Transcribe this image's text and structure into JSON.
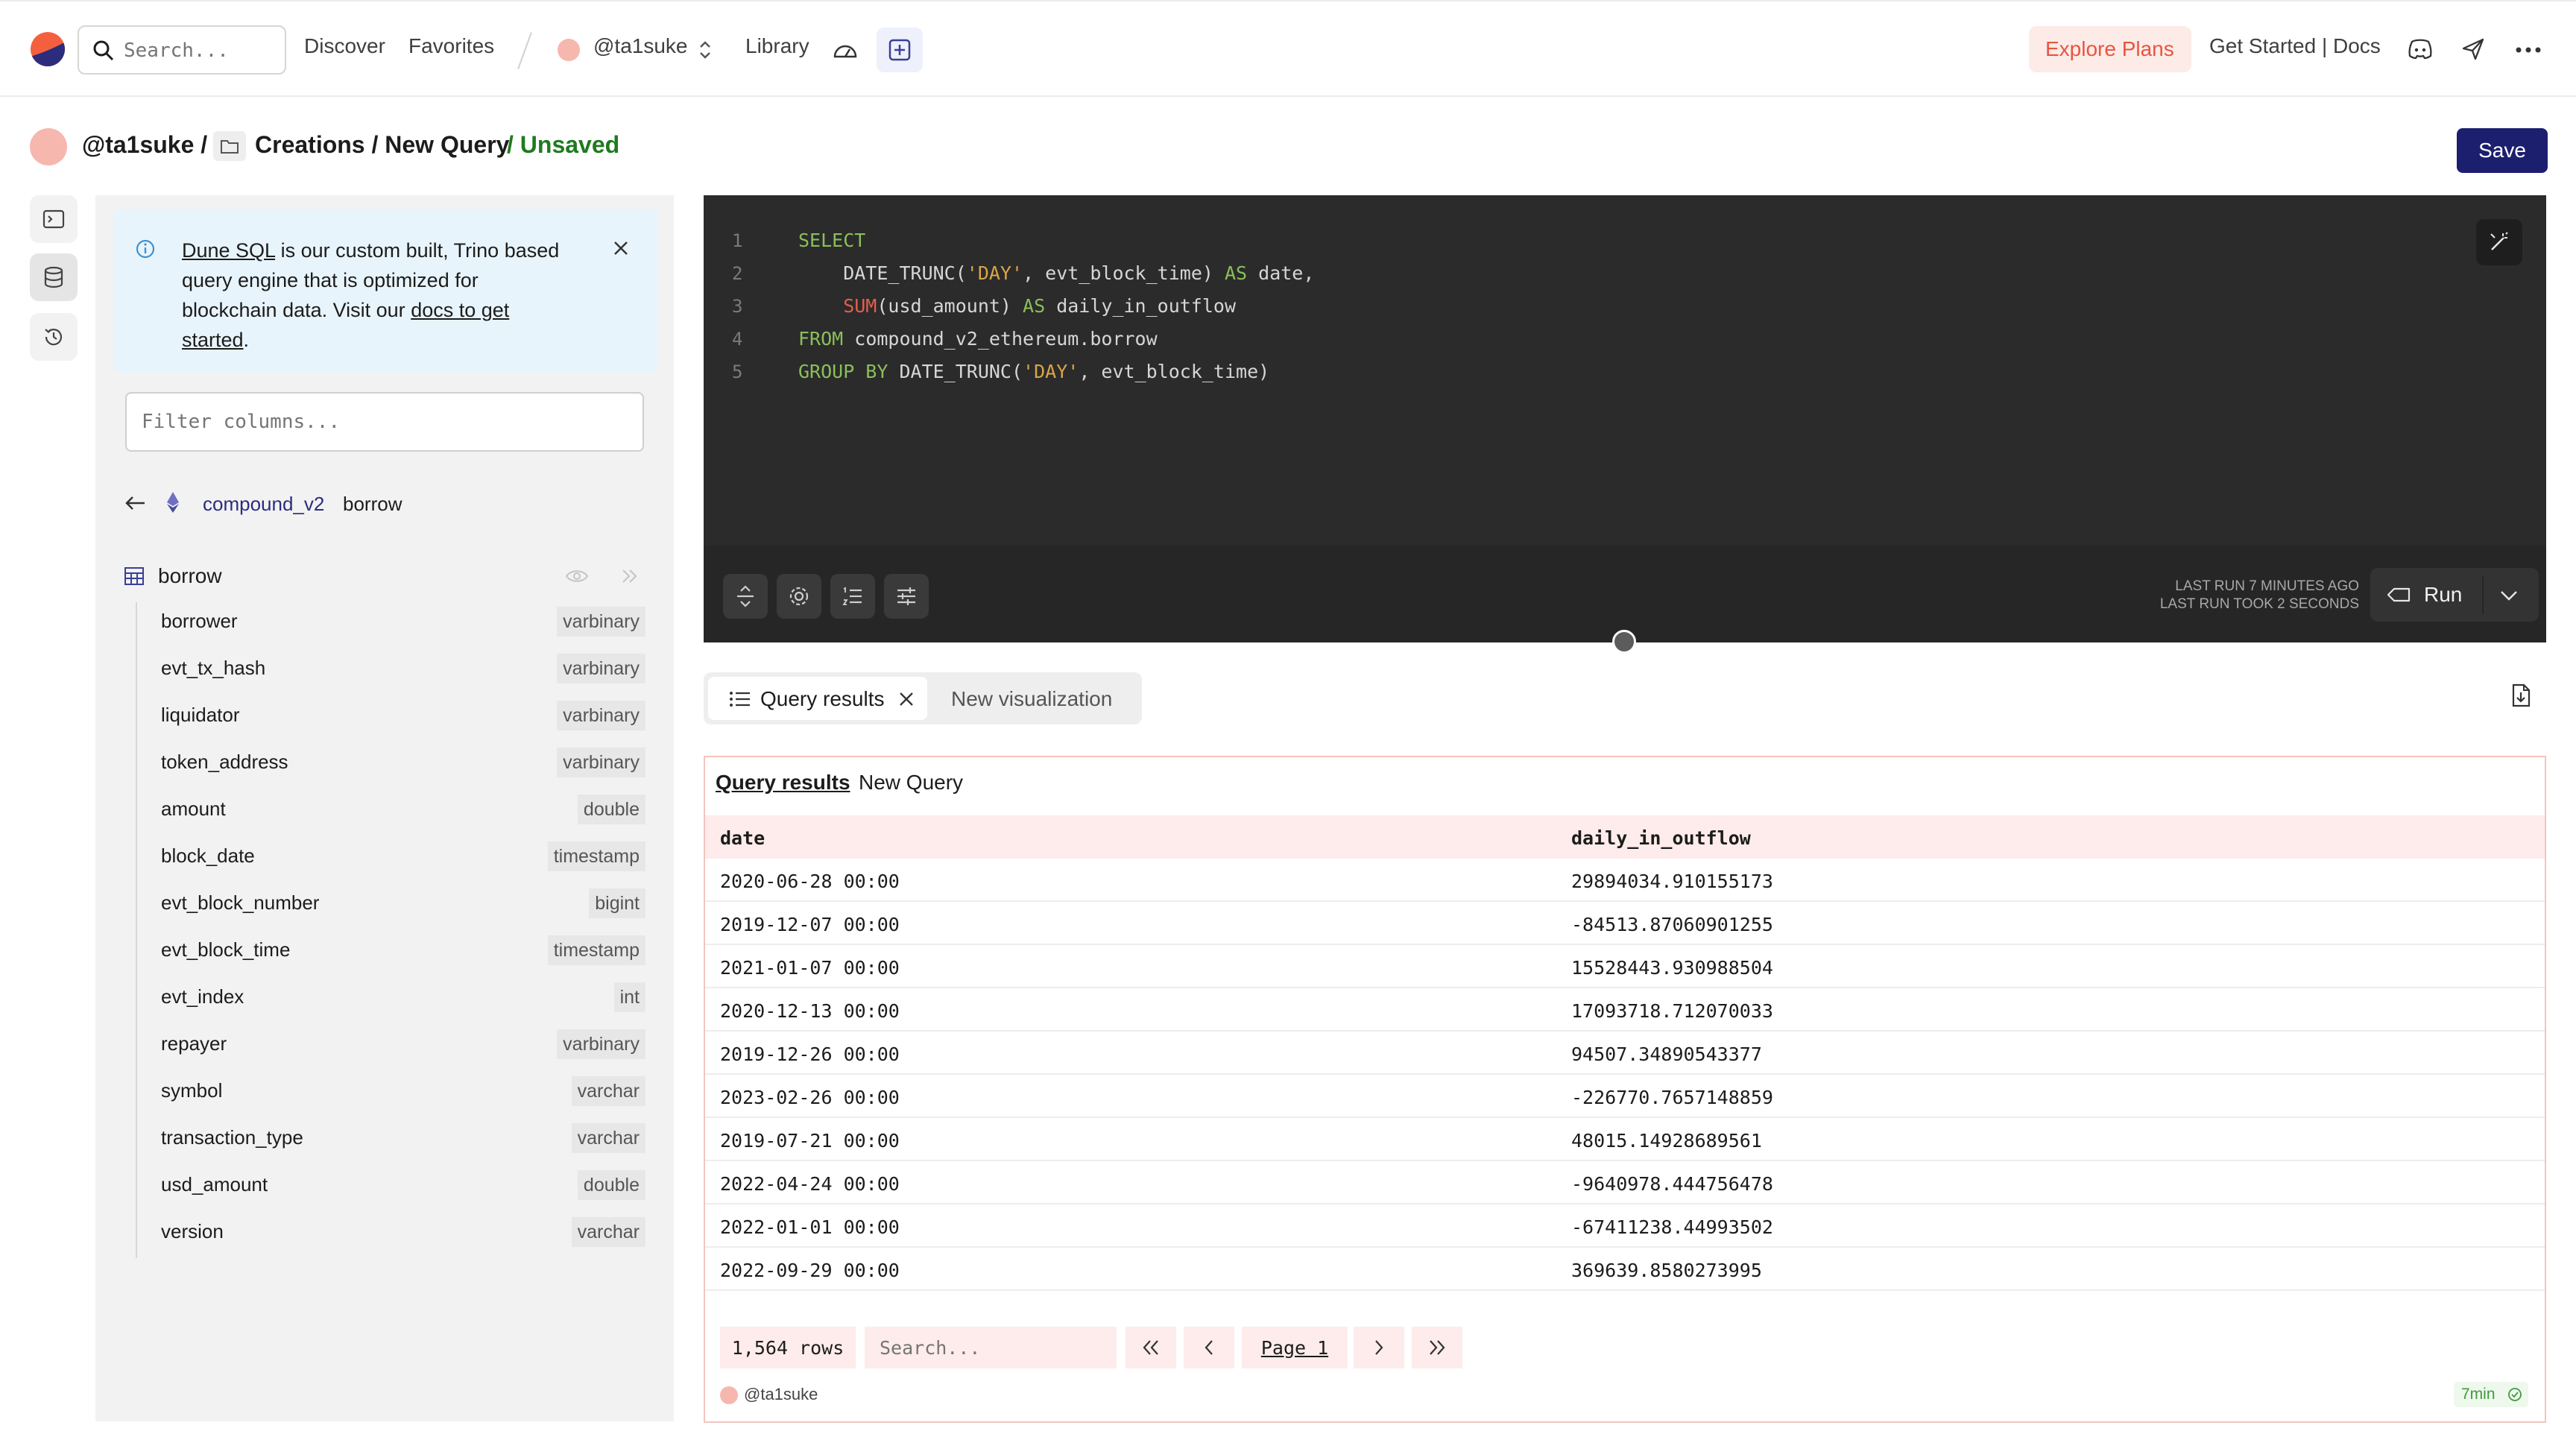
{
  "nav": {
    "search_placeholder": "Search...",
    "discover": "Discover",
    "favorites": "Favorites",
    "user": "@ta1suke",
    "library": "Library",
    "explore_plans": "Explore Plans",
    "get_started_docs": "Get Started | Docs",
    "accent_color": "#e8553f"
  },
  "path": {
    "user": "@ta1suke /",
    "folder": "Creations / New Query",
    "status": "/ Unsaved",
    "save_label": "Save"
  },
  "info_banner": {
    "link1": "Dune SQL",
    "line1_rest": " is our custom built, Trino based",
    "line2": "query engine that is optimized for",
    "line3_pre": "blockchain data. Visit our ",
    "link2": "docs to get",
    "link3": "started",
    "period": "."
  },
  "schema": {
    "filter_placeholder": "Filter columns...",
    "namespace": "compound_v2",
    "table_crumb": "borrow",
    "table_name": "borrow",
    "columns": [
      {
        "name": "borrower",
        "type": "varbinary"
      },
      {
        "name": "evt_tx_hash",
        "type": "varbinary"
      },
      {
        "name": "liquidator",
        "type": "varbinary"
      },
      {
        "name": "token_address",
        "type": "varbinary"
      },
      {
        "name": "amount",
        "type": "double"
      },
      {
        "name": "block_date",
        "type": "timestamp"
      },
      {
        "name": "evt_block_number",
        "type": "bigint"
      },
      {
        "name": "evt_block_time",
        "type": "timestamp"
      },
      {
        "name": "evt_index",
        "type": "int"
      },
      {
        "name": "repayer",
        "type": "varbinary"
      },
      {
        "name": "symbol",
        "type": "varchar"
      },
      {
        "name": "transaction_type",
        "type": "varchar"
      },
      {
        "name": "usd_amount",
        "type": "double"
      },
      {
        "name": "version",
        "type": "varchar"
      }
    ]
  },
  "editor": {
    "line_numbers": [
      "1",
      "2",
      "3",
      "4",
      "5"
    ],
    "line1": {
      "kw": "SELECT"
    },
    "line2": {
      "a": "    DATE_TRUNC(",
      "s": "'DAY'",
      "b": ", evt_block_time) ",
      "kw": "AS",
      "c": " date,"
    },
    "line3": {
      "fn": "    SUM",
      "a": "(usd_amount) ",
      "kw": "AS",
      "b": " daily_in_outflow"
    },
    "line4": {
      "kw": "FROM",
      "a": " compound_v2_ethereum.borrow"
    },
    "line5": {
      "kw": "GROUP BY",
      "a": " DATE_TRUNC(",
      "s": "'DAY'",
      "b": ", evt_block_time)"
    },
    "last_run": "LAST RUN 7 MINUTES AGO",
    "run_took": "LAST RUN TOOK 2 SECONDS",
    "run_label": "Run"
  },
  "tabs": {
    "query_results": "Query results",
    "new_visualization": "New visualization"
  },
  "results": {
    "title": "Query results",
    "query_name": "New Query",
    "columns": [
      "date",
      "daily_in_outflow"
    ],
    "rows": [
      [
        "2020-06-28 00:00",
        "29894034.910155173"
      ],
      [
        "2019-12-07 00:00",
        "-84513.87060901255"
      ],
      [
        "2021-01-07 00:00",
        "15528443.930988504"
      ],
      [
        "2020-12-13 00:00",
        "17093718.712070033"
      ],
      [
        "2019-12-26 00:00",
        "94507.34890543377"
      ],
      [
        "2023-02-26 00:00",
        "-226770.7657148859"
      ],
      [
        "2019-07-21 00:00",
        "48015.14928689561"
      ],
      [
        "2022-04-24 00:00",
        "-9640978.444756478"
      ],
      [
        "2022-01-01 00:00",
        "-67411238.44993502"
      ],
      [
        "2022-09-29 00:00",
        "369639.8580273995"
      ]
    ],
    "row_count": "1,564 rows",
    "search_placeholder": "Search...",
    "page": "Page 1",
    "author": "@ta1suke",
    "age": "7min"
  }
}
